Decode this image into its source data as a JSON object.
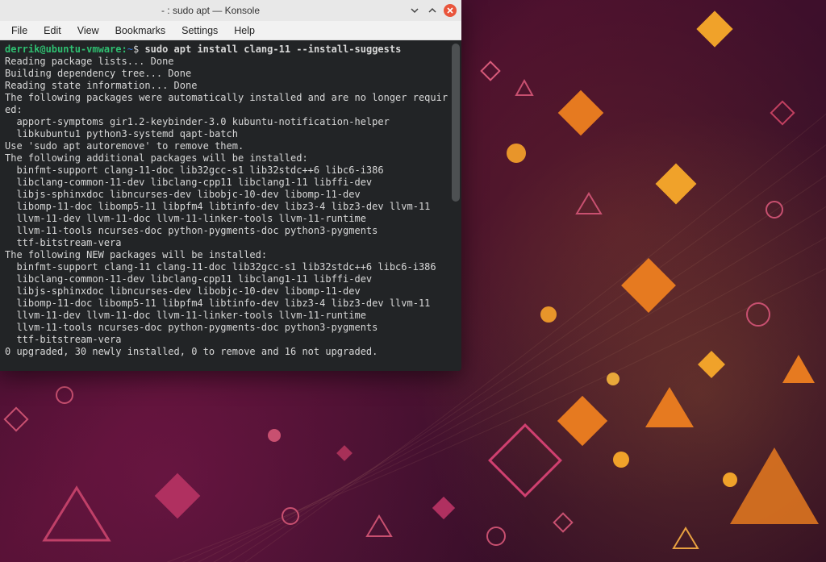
{
  "window": {
    "title": "- : sudo apt — Konsole"
  },
  "menubar": {
    "items": [
      "File",
      "Edit",
      "View",
      "Bookmarks",
      "Settings",
      "Help"
    ]
  },
  "prompt": {
    "user_host": "derrik@ubuntu-vmware",
    "path": "~",
    "symbol": "$",
    "command": "sudo apt install clang-11 --install-suggests"
  },
  "output": [
    "Reading package lists... Done",
    "Building dependency tree... Done",
    "Reading state information... Done",
    "The following packages were automatically installed and are no longer requir",
    "ed:",
    "  apport-symptoms gir1.2-keybinder-3.0 kubuntu-notification-helper",
    "  libkubuntu1 python3-systemd qapt-batch",
    "Use 'sudo apt autoremove' to remove them.",
    "The following additional packages will be installed:",
    "  binfmt-support clang-11-doc lib32gcc-s1 lib32stdc++6 libc6-i386",
    "  libclang-common-11-dev libclang-cpp11 libclang1-11 libffi-dev",
    "  libjs-sphinxdoc libncurses-dev libobjc-10-dev libomp-11-dev",
    "  libomp-11-doc libomp5-11 libpfm4 libtinfo-dev libz3-4 libz3-dev llvm-11",
    "  llvm-11-dev llvm-11-doc llvm-11-linker-tools llvm-11-runtime",
    "  llvm-11-tools ncurses-doc python-pygments-doc python3-pygments",
    "  ttf-bitstream-vera",
    "The following NEW packages will be installed:",
    "  binfmt-support clang-11 clang-11-doc lib32gcc-s1 lib32stdc++6 libc6-i386",
    "  libclang-common-11-dev libclang-cpp11 libclang1-11 libffi-dev",
    "  libjs-sphinxdoc libncurses-dev libobjc-10-dev libomp-11-dev",
    "  libomp-11-doc libomp5-11 libpfm4 libtinfo-dev libz3-4 libz3-dev llvm-11",
    "  llvm-11-dev llvm-11-doc llvm-11-linker-tools llvm-11-runtime",
    "  llvm-11-tools ncurses-doc python-pygments-doc python3-pygments",
    "  ttf-bitstream-vera",
    "0 upgraded, 30 newly installed, 0 to remove and 16 not upgraded."
  ]
}
